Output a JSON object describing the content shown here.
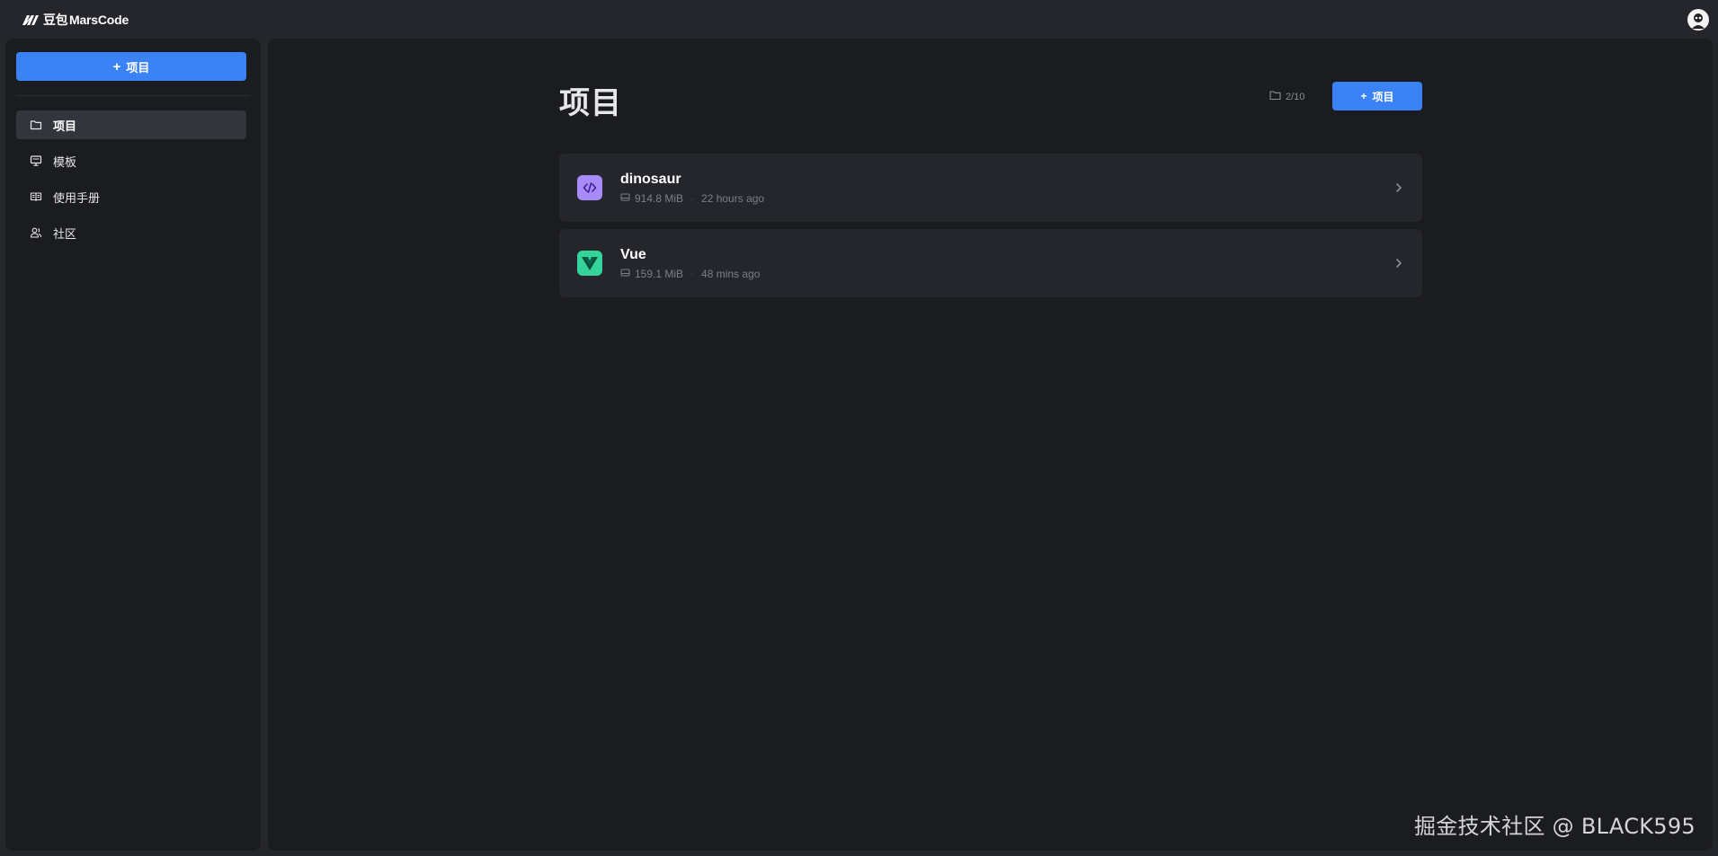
{
  "app": {
    "logo_cn": "豆包",
    "logo_text": "MarsCode"
  },
  "sidebar": {
    "new_button_plus": "+",
    "new_button_label": "项目",
    "items": [
      {
        "label": "项目",
        "icon": "folder-icon",
        "active": true
      },
      {
        "label": "模板",
        "icon": "monitor-icon",
        "active": false
      },
      {
        "label": "使用手册",
        "icon": "book-icon",
        "active": false
      },
      {
        "label": "社区",
        "icon": "users-icon",
        "active": false
      }
    ]
  },
  "main": {
    "title": "项目",
    "counter": "2/10",
    "new_button_plus": "+",
    "new_button_label": "项目",
    "projects": [
      {
        "name": "dinosaur",
        "size": "914.8 MiB",
        "time": "22 hours ago",
        "icon": "code-icon",
        "icon_color": "#a78bfa"
      },
      {
        "name": "Vue",
        "size": "159.1 MiB",
        "time": "48 mins ago",
        "icon": "vue-icon",
        "icon_color": "#34d399"
      }
    ]
  },
  "watermark": "掘金技术社区 @ BLACK595",
  "colors": {
    "accent": "#3b82f6",
    "background": "#1b1c20",
    "surface": "#25262b"
  }
}
